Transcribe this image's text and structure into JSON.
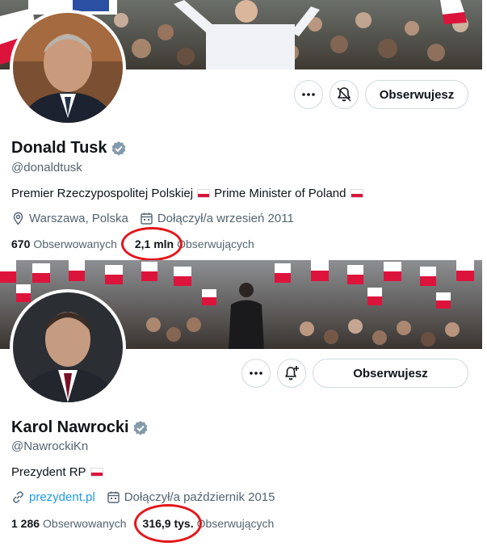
{
  "profiles": [
    {
      "name": "Donald Tusk",
      "handle": "@donaldtusk",
      "bio_parts": [
        "Premier Rzeczypospolitej Polskiej",
        "Prime Minister of Poland"
      ],
      "location": "Warszawa, Polska",
      "link": "",
      "joined": "Dołączył/a wrzesień 2011",
      "following_count": "670",
      "following_label": "Obserwowanych",
      "followers_count": "2,1 mln",
      "followers_label": "Obserwujących",
      "follow_button": "Obserwujesz",
      "icons": {
        "more": "more-icon",
        "notify": "bell-icon",
        "verified": "verified-badge-icon",
        "location": "location-pin-icon",
        "calendar": "calendar-icon"
      }
    },
    {
      "name": "Karol Nawrocki",
      "handle": "@NawrockiKn",
      "bio_parts": [
        "Prezydent RP"
      ],
      "location": "",
      "link": "prezydent.pl",
      "joined": "Dołączył/a październik 2015",
      "following_count": "1 286",
      "following_label": "Obserwowanych",
      "followers_count": "316,9 tys.",
      "followers_label": "Obserwujących",
      "follow_button": "Obserwujesz",
      "icons": {
        "more": "more-icon",
        "notify": "bell-plus-icon",
        "verified": "verified-badge-icon",
        "link": "link-icon",
        "calendar": "calendar-icon"
      }
    }
  ],
  "colors": {
    "accent": "#1d9bf0",
    "annotation": "#e3161b",
    "verified": "#829aab",
    "flag_red": "#dc143c"
  }
}
